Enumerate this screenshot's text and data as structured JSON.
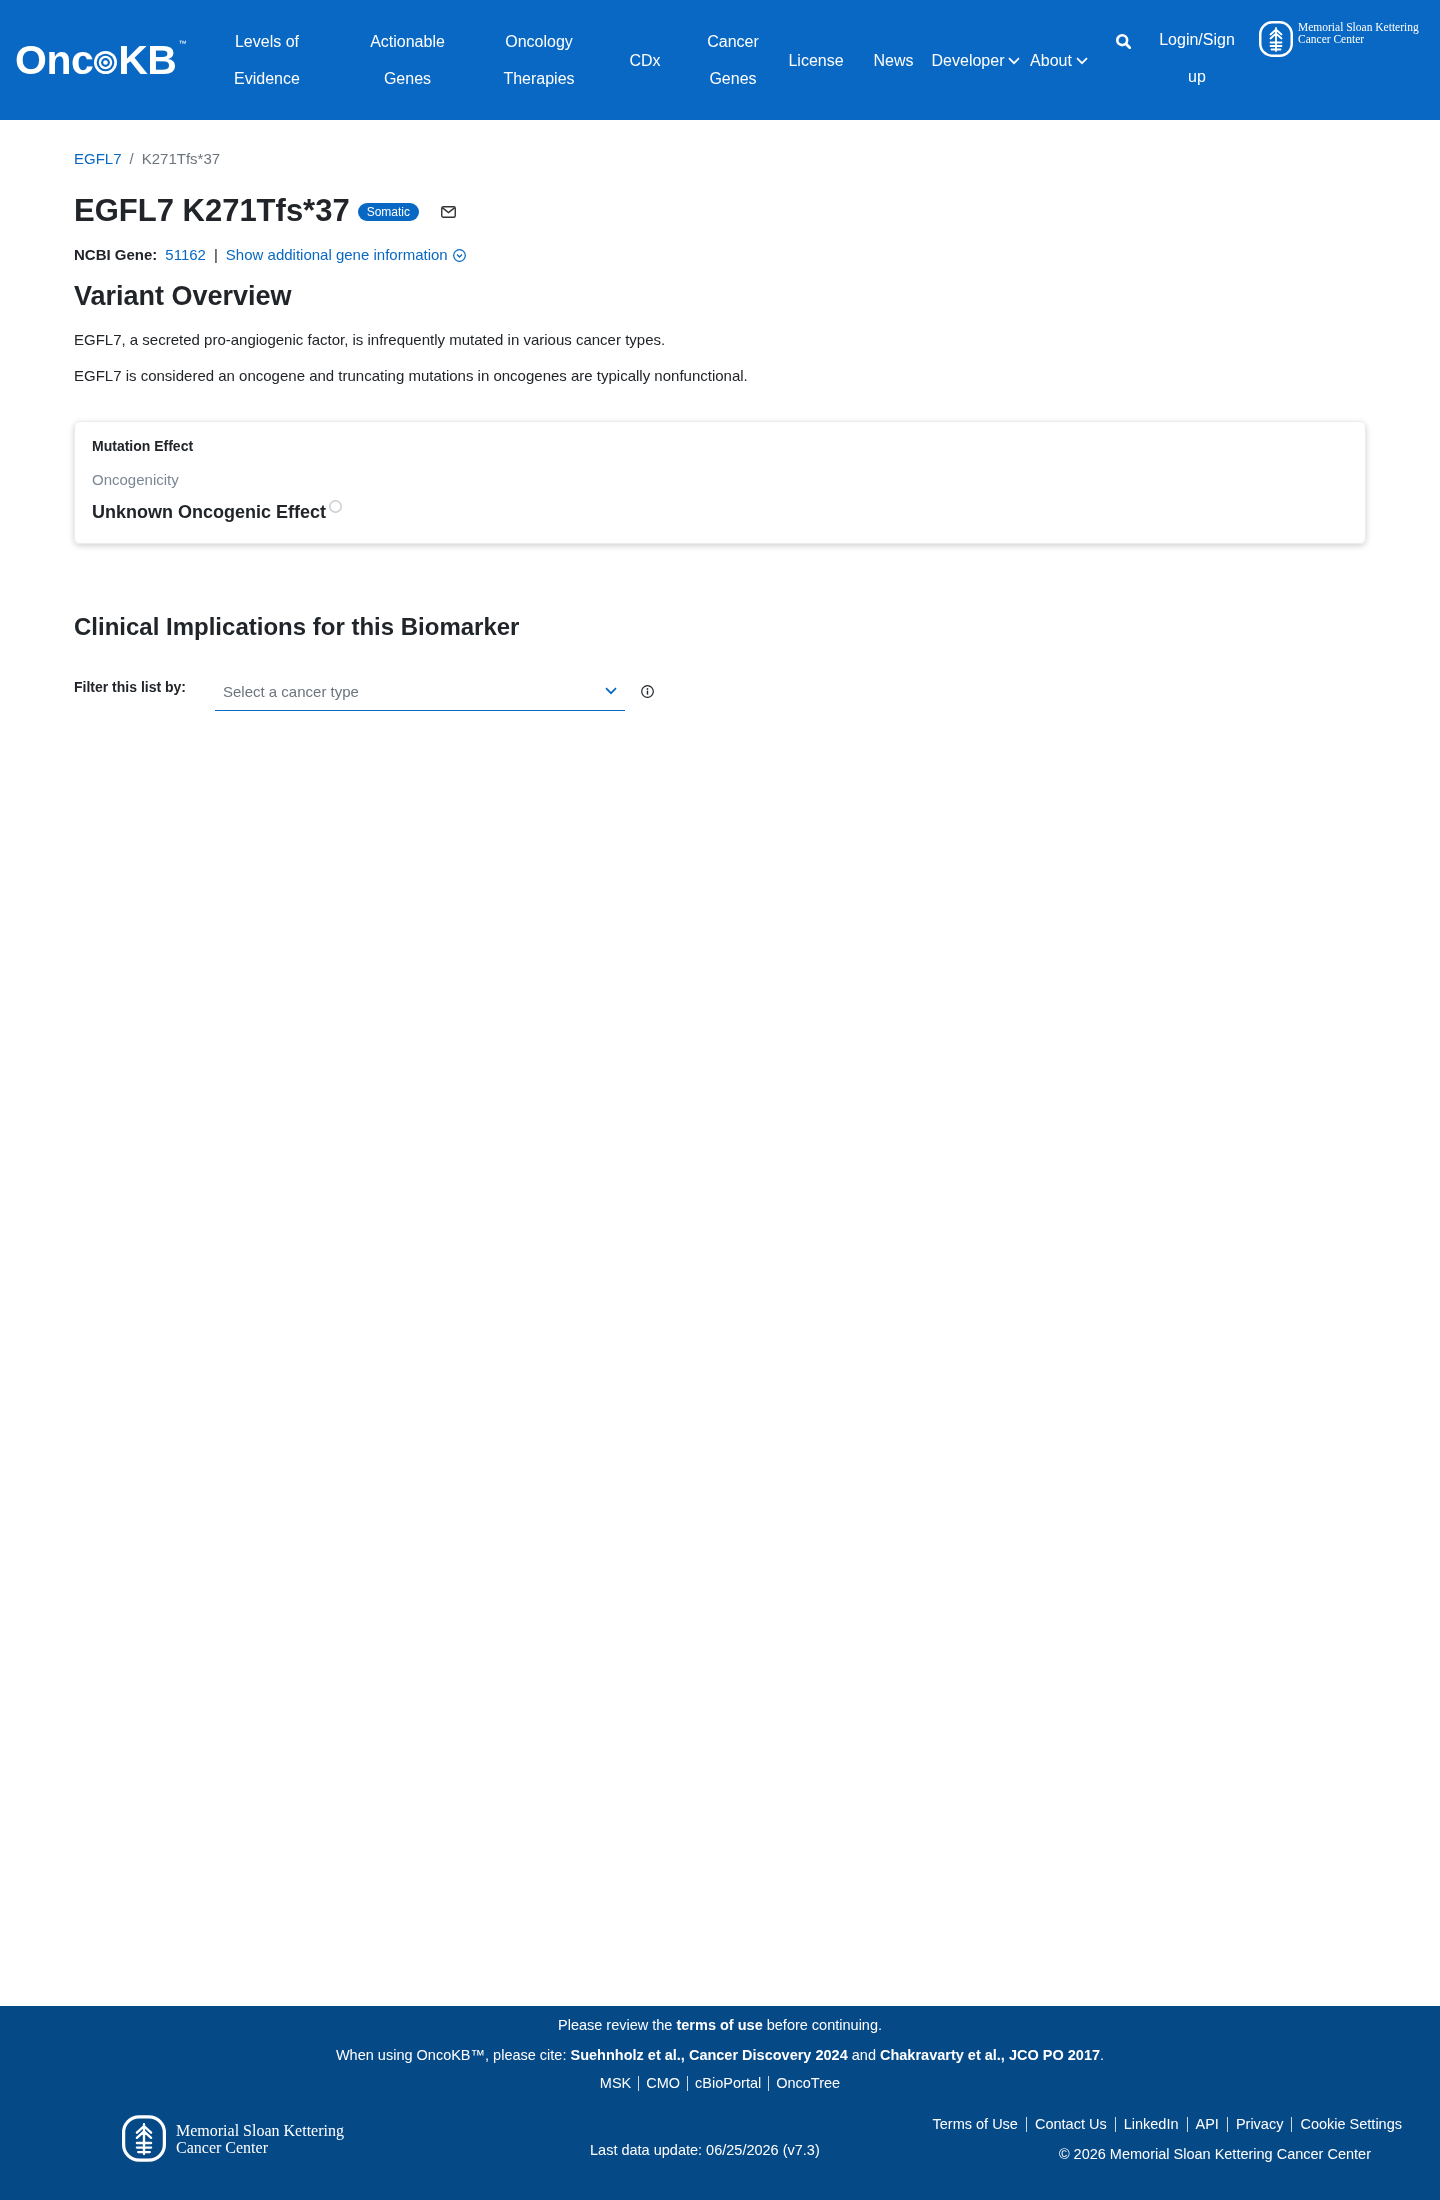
{
  "header": {
    "logo": {
      "before": "Onc",
      "after": "KB",
      "mark": "™"
    },
    "nav": [
      {
        "label": "Levels of Evidence",
        "kind": "link"
      },
      {
        "label": "Actionable Genes",
        "kind": "link"
      },
      {
        "label": "Oncology Therapies",
        "kind": "link"
      },
      {
        "label": "CDx",
        "kind": "link"
      },
      {
        "label": "Cancer Genes",
        "kind": "link"
      },
      {
        "label": "License",
        "kind": "link"
      },
      {
        "label": "News",
        "kind": "link"
      },
      {
        "label": "Developer",
        "kind": "dropdown"
      },
      {
        "label": "About",
        "kind": "dropdown"
      }
    ],
    "login": "Login/Sign up",
    "partner_logo": "Memorial Sloan Kettering\nCancer Center"
  },
  "breadcrumb": {
    "separator": "/",
    "items": [
      {
        "label": "EGFL7",
        "kind": "link"
      },
      {
        "label": "K271Tfs*37",
        "kind": "current"
      }
    ]
  },
  "title": "EGFL7 K271Tfs*37",
  "badge": "Somatic",
  "gene_info": {
    "label": "NCBI Gene:",
    "gene_id": "51162",
    "separator": "|",
    "more_link": "Show additional gene information"
  },
  "overview": {
    "heading": "Variant Overview",
    "paragraphs": [
      "EGFL7, a secreted pro-angiogenic factor, is infrequently mutated in various cancer types.",
      "EGFL7 is considered an oncogene and truncating mutations in oncogenes are typically nonfunctional."
    ]
  },
  "mutation_effect": {
    "title": "Mutation Effect",
    "label": "Oncogenicity",
    "value": "Unknown Oncogenic Effect"
  },
  "clinical": {
    "heading": "Clinical Implications for this Biomarker",
    "filter": {
      "label": "Filter this list by:",
      "placeholder": "Select a cancer type"
    }
  },
  "footer": {
    "notices": [
      {
        "parts": [
          {
            "kind": "text",
            "text": "Please review the "
          },
          {
            "kind": "link",
            "text": "terms of use"
          },
          {
            "kind": "text",
            "text": " before continuing."
          }
        ]
      },
      {
        "parts": [
          {
            "kind": "text",
            "text": "When using OncoKB™, please cite: "
          },
          {
            "kind": "link",
            "text": "Suehnholz et al., Cancer Discovery 2024"
          },
          {
            "kind": "text",
            "text": " and "
          },
          {
            "kind": "link",
            "text": "Chakravarty et al., JCO PO 2017"
          },
          {
            "kind": "text",
            "text": "."
          }
        ]
      }
    ],
    "links": [
      "MSK",
      "CMO",
      "cBioPortal",
      "OncoTree"
    ],
    "logo": "Memorial Sloan Kettering\nCancer Center",
    "last_update": "Last data update: 06/25/2026 (v7.3)",
    "legal_links": [
      "Terms of Use",
      "Contact Us",
      "LinkedIn",
      "API",
      "Privacy",
      "Cookie Settings"
    ],
    "copyright": "© 2026 Memorial Sloan Kettering Cancer Center"
  }
}
